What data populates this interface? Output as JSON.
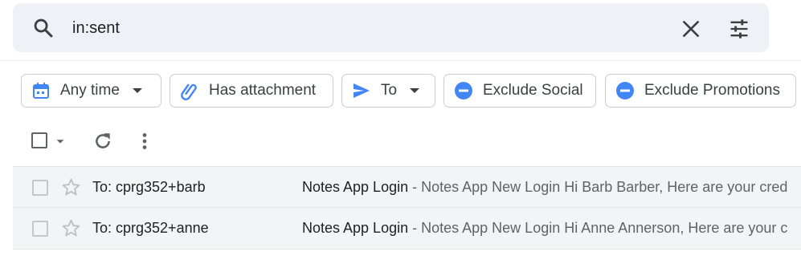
{
  "search": {
    "query": "in:sent",
    "search_icon": "search-icon",
    "clear_icon": "close-icon",
    "options_icon": "tune-icon"
  },
  "filters": [
    {
      "label": "Any time",
      "icon": "calendar-icon",
      "has_dropdown": true
    },
    {
      "label": "Has attachment",
      "icon": "attachment-icon",
      "has_dropdown": false
    },
    {
      "label": "To",
      "icon": "send-icon",
      "has_dropdown": true
    },
    {
      "label": "Exclude Social",
      "icon": "minus-circle-icon",
      "has_dropdown": false
    },
    {
      "label": "Exclude Promotions",
      "icon": "minus-circle-icon",
      "has_dropdown": false
    }
  ],
  "toolbar": {
    "select_all_icon": "checkbox-icon",
    "select_menu_icon": "chevron-down-icon",
    "refresh_icon": "refresh-icon",
    "more_icon": "more-vert-icon"
  },
  "emails": [
    {
      "sender": "To: cprg352+barb",
      "subject": "Notes App Login",
      "separator": " - ",
      "snippet": "Notes App New Login Hi Barb Barber, Here are your cred"
    },
    {
      "sender": "To: cprg352+anne",
      "subject": "Notes App Login",
      "separator": " - ",
      "snippet": "Notes App New Login Hi Anne Annerson, Here are your c"
    }
  ],
  "colors": {
    "accent": "#4285f4",
    "search_bg": "#eef1f5",
    "row_bg": "#f2f5f5",
    "icon_gray": "#5f6368"
  }
}
